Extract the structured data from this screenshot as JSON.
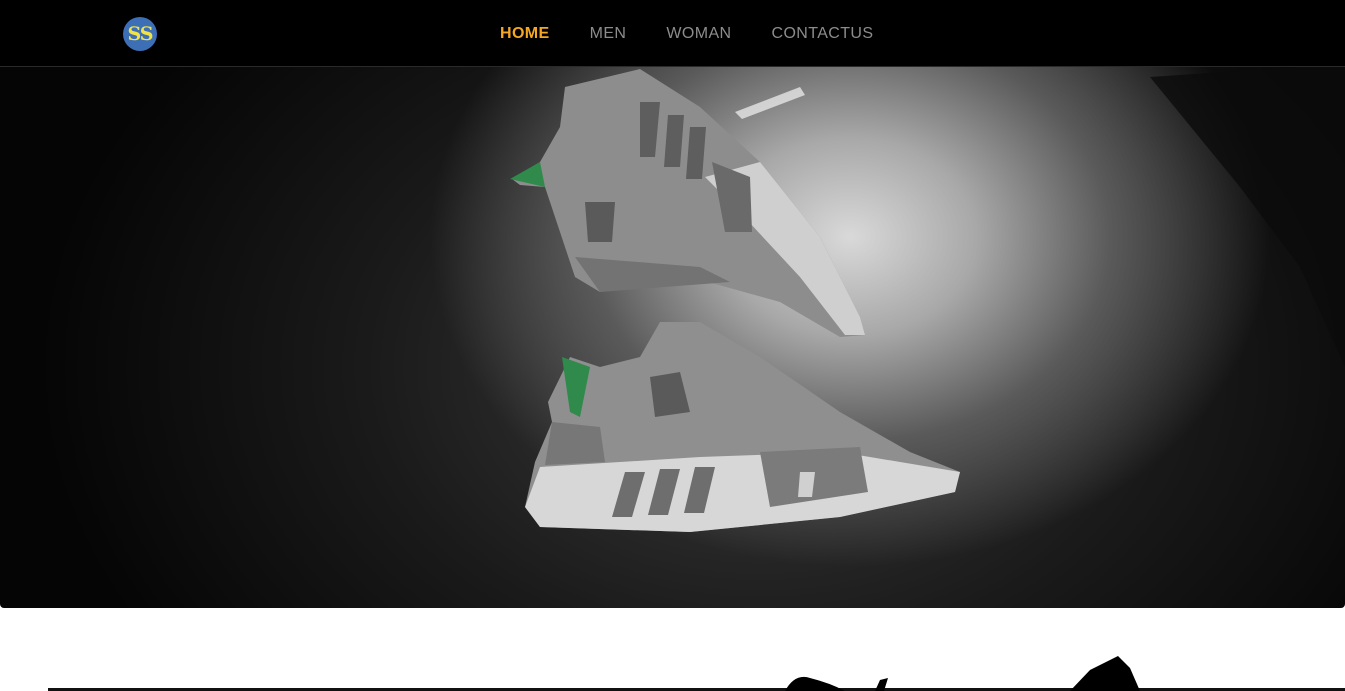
{
  "logo": {
    "text": "SS"
  },
  "nav": {
    "items": [
      {
        "label": "HOME",
        "active": true
      },
      {
        "label": "MEN",
        "active": false
      },
      {
        "label": "WOMAN",
        "active": false
      },
      {
        "label": "CONTACTUS",
        "active": false
      }
    ]
  },
  "hero": {
    "image": "sneakers-photo"
  },
  "colors": {
    "nav_background": "#000000",
    "active_link": "#f5a623",
    "inactive_link": "#8c8c8c",
    "logo_circle": "#3d6fb6",
    "logo_text": "#f2e245"
  }
}
